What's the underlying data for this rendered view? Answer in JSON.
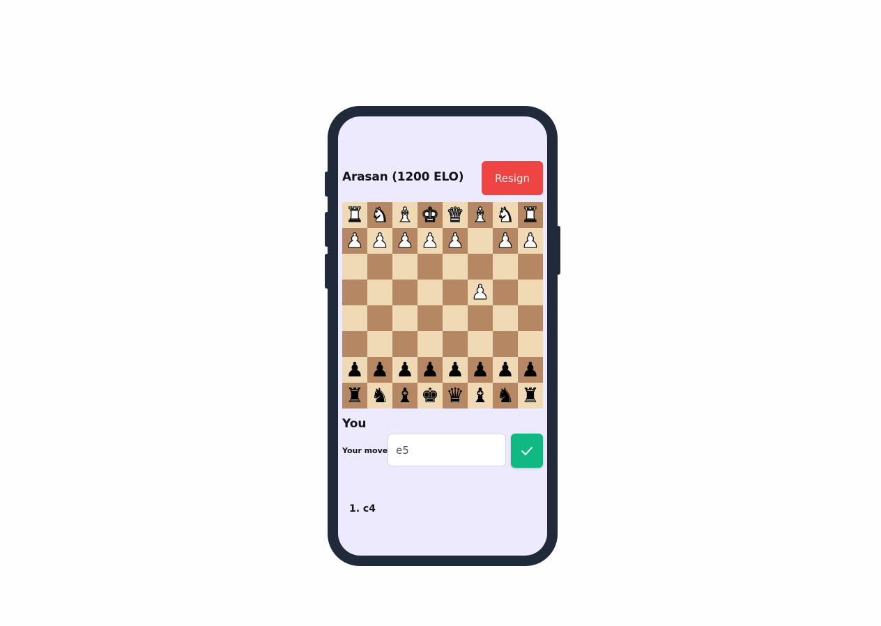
{
  "opponent": {
    "name": "Arasan (1200 ELO)",
    "resign_label": "Resign",
    "resign_color": "#ef4444"
  },
  "board": {
    "light_color": "#f0d9b5",
    "dark_color": "#b58863",
    "ranks": [
      [
        "wR",
        "wN",
        "wB",
        "wK",
        "wQ",
        "wB",
        "wN",
        "wR"
      ],
      [
        "wP",
        "wP",
        "wP",
        "wP",
        "wP",
        "",
        "wP",
        "wP"
      ],
      [
        "",
        "",
        "",
        "",
        "",
        "",
        "",
        ""
      ],
      [
        "",
        "",
        "",
        "",
        "",
        "wP",
        "",
        ""
      ],
      [
        "",
        "",
        "",
        "",
        "",
        "",
        "",
        ""
      ],
      [
        "",
        "",
        "",
        "",
        "",
        "",
        "",
        ""
      ],
      [
        "bP",
        "bP",
        "bP",
        "bP",
        "bP",
        "bP",
        "bP",
        "bP"
      ],
      [
        "bR",
        "bN",
        "bB",
        "bK",
        "bQ",
        "bB",
        "bN",
        "bR"
      ]
    ]
  },
  "player": {
    "name": "You",
    "move_label": "Your move:",
    "move_value": "e5",
    "submit_icon": "check-icon",
    "submit_color": "#10b981"
  },
  "history": {
    "moves": "1. c4"
  }
}
